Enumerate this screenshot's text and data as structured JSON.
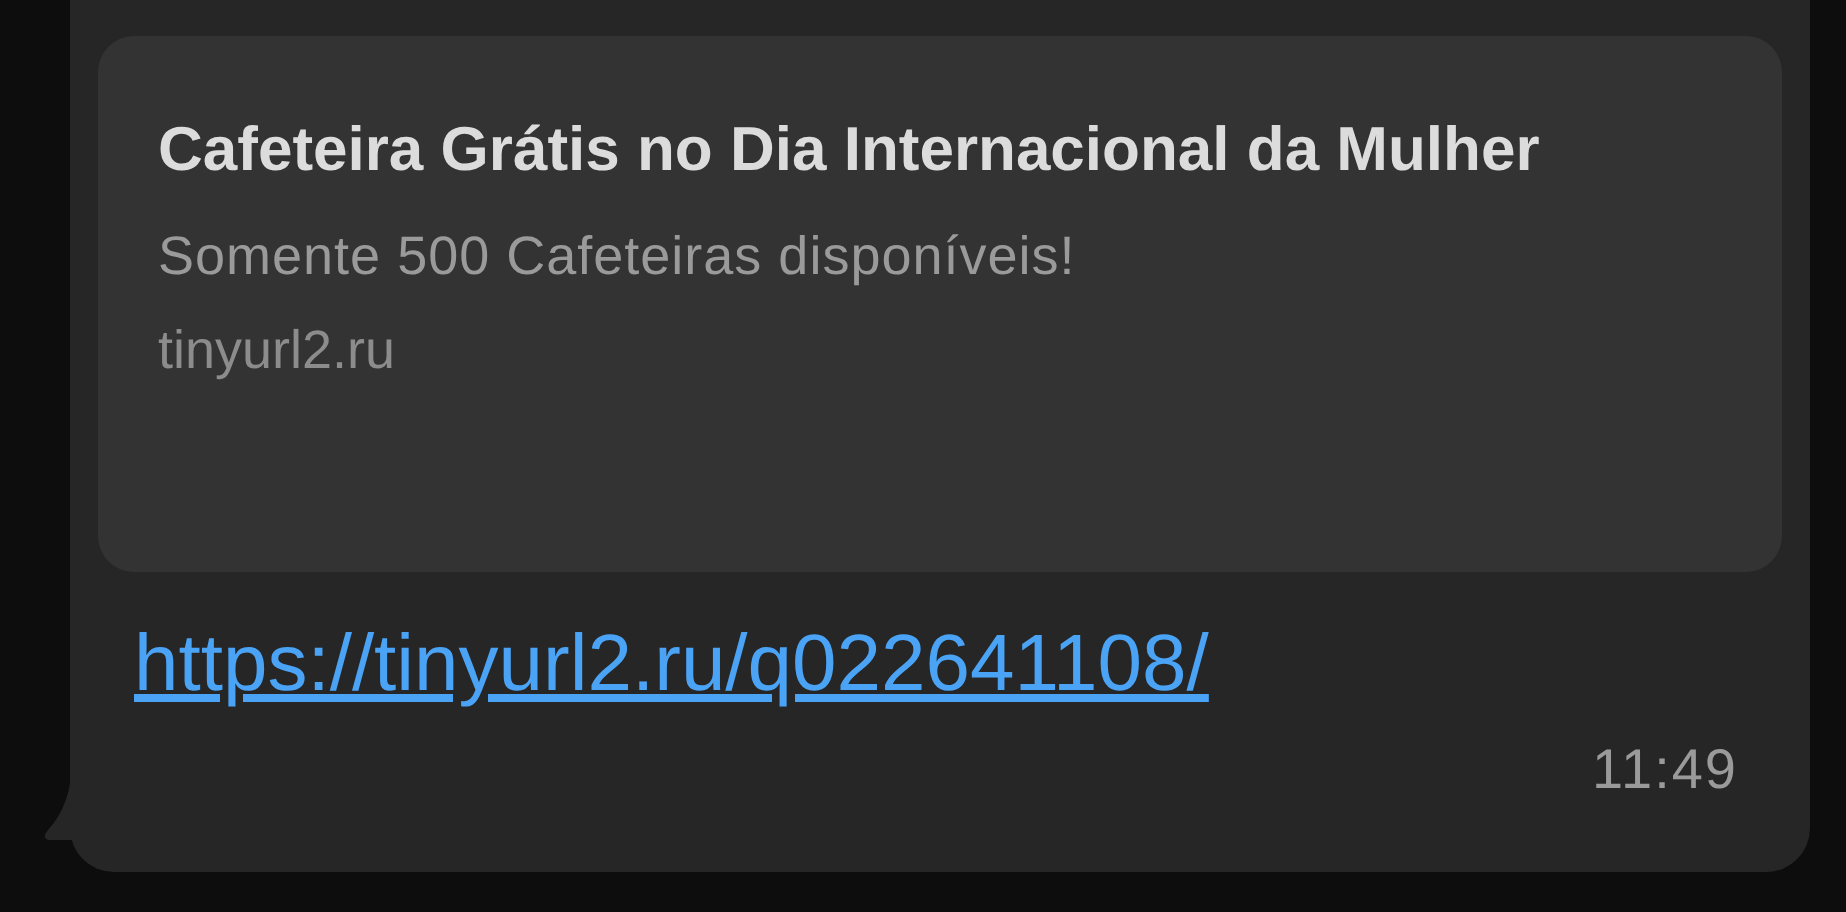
{
  "message": {
    "preview": {
      "title": "Cafeteira Grátis no Dia Internacional da Mulher",
      "description": "Somente 500 Cafeteiras disponíveis!",
      "domain": "tinyurl2.ru"
    },
    "link": "https://tinyurl2.ru/q022641108/",
    "time": "11:49"
  }
}
